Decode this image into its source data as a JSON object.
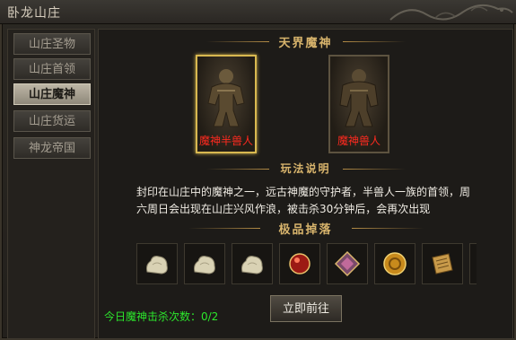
{
  "window": {
    "title": "卧龙山庄"
  },
  "tabs": [
    {
      "label": "山庄圣物"
    },
    {
      "label": "山庄首领"
    },
    {
      "label": "山庄魔神"
    },
    {
      "label": "山庄货运"
    },
    {
      "label": "神龙帝国"
    }
  ],
  "active_tab": "山庄魔神",
  "bosses": {
    "title": "天界魔神",
    "items": [
      {
        "name": "魔神半兽人"
      },
      {
        "name": "魔神兽人"
      }
    ]
  },
  "rules": {
    "title": "玩法说明",
    "line1": "封印在山庄中的魔神之一，远古神魔的守护者，半兽人一族的首领，周",
    "line2": "六周日会出现在山庄兴风作浪，被击杀30分钟后，会再次出现"
  },
  "drops": {
    "title": "极品掉落",
    "items": [
      "stone-icon",
      "stone-icon",
      "stone-icon",
      "red-orb-icon",
      "gem-box-icon",
      "gold-coin-icon",
      "scroll-icon"
    ]
  },
  "footer": {
    "kill_count": "今日魔神击杀次数：0/2",
    "go_label": "立即前往"
  },
  "colors": {
    "accent_gold": "#d8b46c",
    "boss_name_red": "#ff2a1f",
    "count_green": "#2ce62c"
  }
}
